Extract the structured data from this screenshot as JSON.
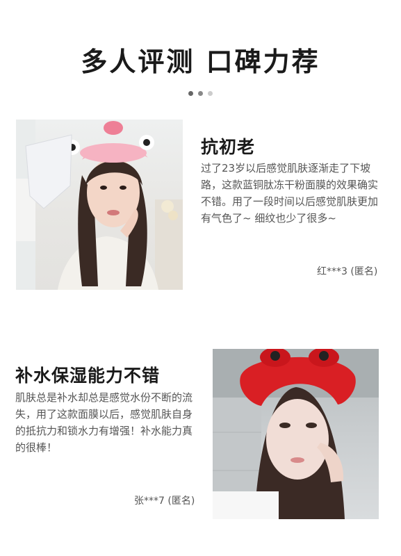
{
  "header": {
    "title": "多人评测 口碑力荐",
    "dots": [
      "#666666",
      "#888888",
      "#cccccc"
    ]
  },
  "reviews": [
    {
      "heading": "抗初老",
      "body": "过了23岁以后感觉肌肤逐渐走了下坡路，这款蓝铜肽冻干粉面膜的效果确实不错。用了一段时间以后感觉肌肤更加有气色了~ 细纹也少了很多~",
      "reviewer": "红***3 (匿名)",
      "photo_icon": "woman-with-sheet-mask-photo"
    },
    {
      "heading": "补水保湿能力不错",
      "body": "肌肤总是补水却总是感觉水份不断的流失，用了这款面膜以后，感觉肌肤自身的抵抗力和锁水力有增强！补水能力真的很棒！",
      "reviewer": "张***7 (匿名)",
      "photo_icon": "woman-with-red-headband-photo"
    }
  ]
}
